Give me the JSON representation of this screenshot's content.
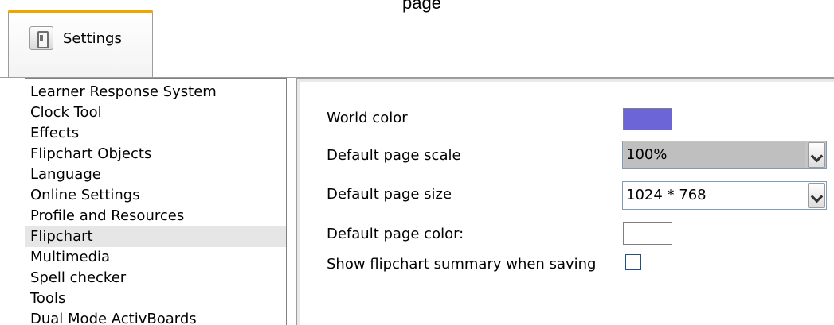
{
  "page": {
    "caption": "page"
  },
  "tab": {
    "label": "Settings",
    "icon": "settings-icon"
  },
  "left_list": {
    "items": [
      {
        "label": "Learner Response System",
        "selected": false
      },
      {
        "label": "Clock Tool",
        "selected": false
      },
      {
        "label": "Effects",
        "selected": false
      },
      {
        "label": "Flipchart Objects",
        "selected": false
      },
      {
        "label": "Language",
        "selected": false
      },
      {
        "label": "Online Settings",
        "selected": false
      },
      {
        "label": "Profile and Resources",
        "selected": false
      },
      {
        "label": "Flipchart",
        "selected": true
      },
      {
        "label": "Multimedia",
        "selected": false
      },
      {
        "label": "Spell checker",
        "selected": false
      },
      {
        "label": "Tools",
        "selected": false
      },
      {
        "label": "Dual Mode ActivBoards",
        "selected": false
      }
    ]
  },
  "settings": {
    "world_color": {
      "label": "World color",
      "color": "#6b65d8"
    },
    "page_scale": {
      "label": "Default page scale",
      "value": "100%"
    },
    "page_size": {
      "label": "Default page size",
      "value": "1024 * 768"
    },
    "page_color": {
      "label": "Default page color:",
      "color": "#ffffff"
    },
    "summary": {
      "label": "Show flipchart summary when saving",
      "checked": false
    }
  },
  "colors": {
    "tab_accent": "#f1a500",
    "selection": "#e6e6e6"
  }
}
